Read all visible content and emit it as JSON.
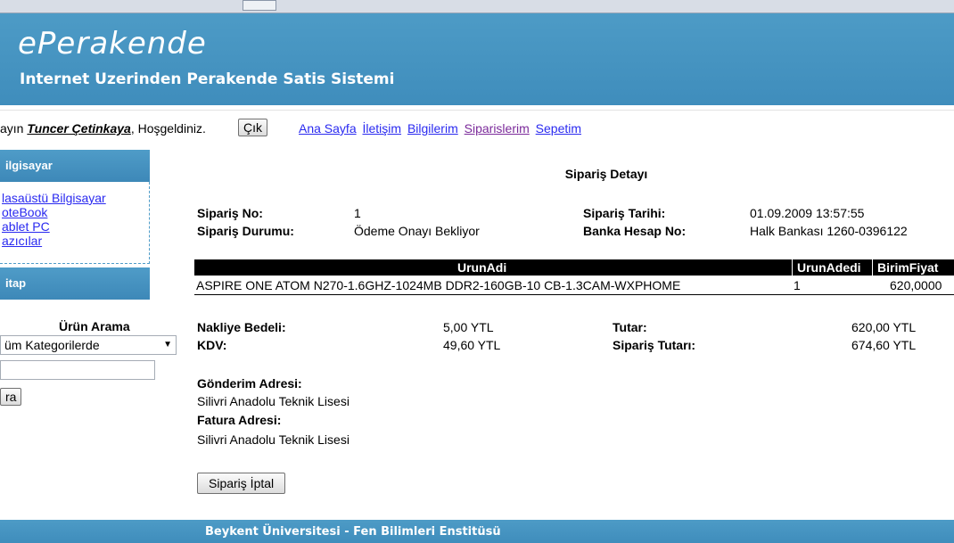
{
  "header": {
    "brand": "ePerakende",
    "tagline": "Internet Uzerinden Perakende Satis Sistemi"
  },
  "user_bar": {
    "greeting_prefix": "ayın ",
    "user_name": "Tuncer Çetinkaya",
    "greeting_suffix": ", Hoşgeldiniz.",
    "logout_label": "Çık",
    "nav_links": [
      "Ana Sayfa",
      "İletişim",
      "Bilgilerim",
      "Siparislerim",
      "Sepetim"
    ]
  },
  "sidebar": {
    "cat_header_1": "ilgisayar",
    "items": [
      "lasaüstü Bilgisayar",
      "oteBook",
      "ablet PC",
      "azıcılar"
    ],
    "cat_header_2": "itap",
    "search_title": "Ürün Arama",
    "search_category": "üm Kategorilerde",
    "search_button": "ra"
  },
  "order": {
    "title": "Sipariş Detayı",
    "no_label": "Sipariş No:",
    "no_value": "1",
    "status_label": "Sipariş Durumu:",
    "status_value": "Ödeme Onayı Bekliyor",
    "date_label": "Sipariş Tarihi:",
    "date_value": "01.09.2009 13:57:55",
    "bank_label": "Banka Hesap No:",
    "bank_value": "Halk Bankası 1260-0396122",
    "table": {
      "columns": [
        "UrunAdi",
        "UrunAdedi",
        "BirimFiyat"
      ],
      "rows": [
        [
          "ASPIRE ONE ATOM N270-1.6GHZ-1024MB DDR2-160GB-10 CB-1.3CAM-WXPHOME",
          "1",
          "620,0000"
        ]
      ]
    },
    "shipping_label": "Nakliye Bedeli:",
    "shipping_value": "5,00 YTL",
    "kdv_label": "KDV:",
    "kdv_value": "49,60 YTL",
    "amount_label": "Tutar:",
    "amount_value": "620,00 YTL",
    "total_label": "Sipariş Tutarı:",
    "total_value": "674,60 YTL",
    "ship_addr_label": "Gönderim Adresi:",
    "ship_addr_value": "Silivri Anadolu Teknik Lisesi",
    "bill_addr_label": "Fatura Adresi:",
    "bill_addr_value": "Silivri Anadolu Teknik Lisesi",
    "cancel_button": "Sipariş İptal"
  },
  "footer": {
    "text": "Beykent Üniversitesi - Fen Bilimleri Enstitüsü"
  },
  "colors": {
    "header_blue": "#4d9bc6",
    "link_blue": "#2a2af0",
    "link_visited": "#7b2a9a"
  }
}
